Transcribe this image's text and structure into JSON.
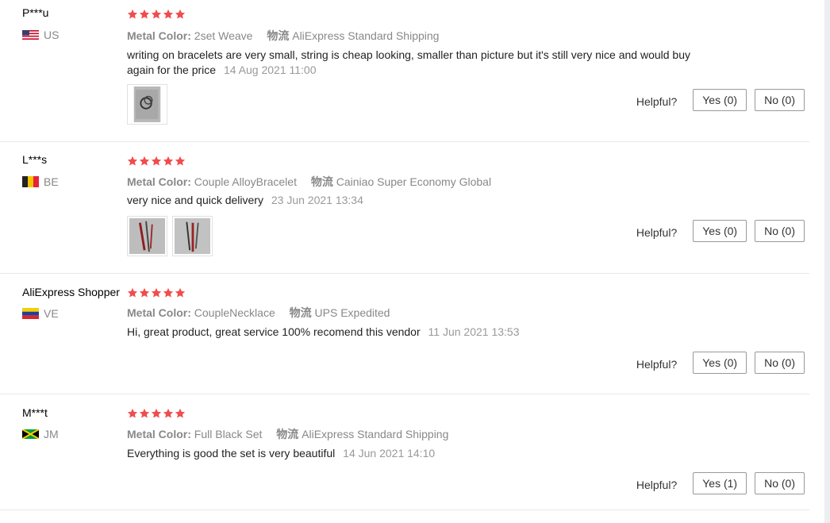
{
  "colors": {
    "star": "#f04d4d",
    "divider": "#e8e8e8"
  },
  "labels": {
    "metal_color": "Metal Color:",
    "shipping": "物流",
    "helpful": "Helpful?"
  },
  "reviews": [
    {
      "user": "P***u",
      "country": "US",
      "flag": "us-flag-icon",
      "stars": 5,
      "metal_color": "2set Weave",
      "shipping": "AliExpress Standard Shipping",
      "text": "writing on bracelets are very small, string is cheap looking, smaller than picture but it's still very nice and would buy again for the price",
      "date": "14 Aug 2021 11:00",
      "yes": "Yes (0)",
      "no": "No (0)"
    },
    {
      "user": "L***s",
      "country": "BE",
      "flag": "be-flag-icon",
      "stars": 5,
      "metal_color": "Couple AlloyBracelet",
      "shipping": "Cainiao Super Economy Global",
      "text": "very nice and quick delivery",
      "date": "23 Jun 2021 13:34",
      "yes": "Yes (0)",
      "no": "No (0)"
    },
    {
      "user": "AliExpress Shopper",
      "country": "VE",
      "flag": "ve-flag-icon",
      "stars": 5,
      "metal_color": "CoupleNecklace",
      "shipping": "UPS Expedited",
      "text": "Hi, great product, great service 100% recomend this vendor",
      "date": "11 Jun 2021 13:53",
      "yes": "Yes (0)",
      "no": "No (0)"
    },
    {
      "user": "M***t",
      "country": "JM",
      "flag": "jm-flag-icon",
      "stars": 5,
      "metal_color": "Full Black Set",
      "shipping": "AliExpress Standard Shipping",
      "text": "Everything is good the set is very beautiful",
      "date": "14 Jun 2021 14:10",
      "yes": "Yes (1)",
      "no": "No (0)"
    }
  ]
}
